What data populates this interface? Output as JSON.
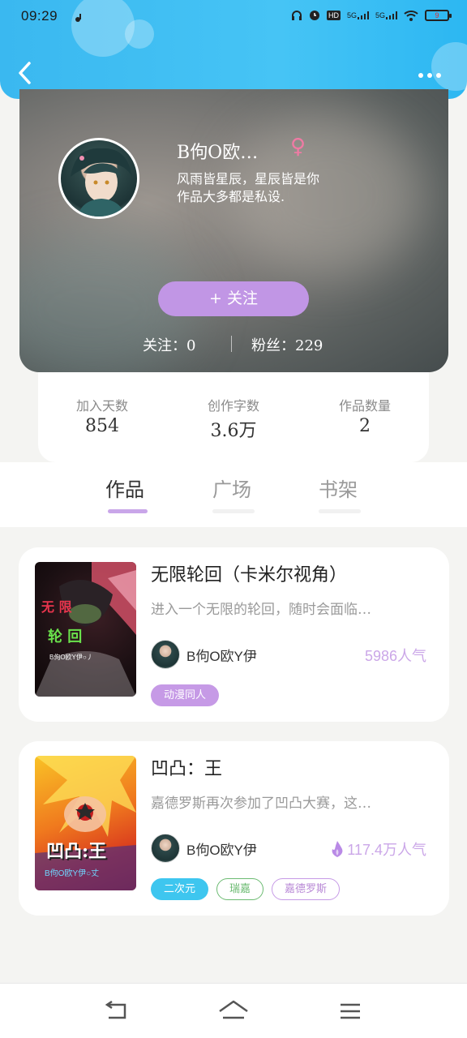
{
  "status_bar": {
    "time": "09:29",
    "network_1": "5G",
    "network_2": "5G",
    "battery": "9"
  },
  "header": {
    "back_icon": "chevron-left-icon",
    "more_icon": "more-dots-icon"
  },
  "profile": {
    "username": "B佝O欧…",
    "gender_symbol": "♀",
    "bio_line1": "风雨皆星辰，星辰皆是你",
    "bio_line2": "作品大多都是私设.",
    "follow_button": "+  关注",
    "following_label": "关注：",
    "following_count": "0",
    "fans_label": "粉丝：",
    "fans_count": "229"
  },
  "stats": [
    {
      "label": "加入天数",
      "value": "854"
    },
    {
      "label": "创作字数",
      "value": "3.6万"
    },
    {
      "label": "作品数量",
      "value": "2"
    }
  ],
  "tabs": [
    {
      "label": "作品",
      "active": true
    },
    {
      "label": "广场",
      "active": false
    },
    {
      "label": "书架",
      "active": false
    }
  ],
  "works": [
    {
      "title": "无限轮回（卡米尔视角）",
      "description": "进入一个无限的轮回，随时会面临…",
      "author": "B佝O欧Y伊",
      "popularity": "5986人气",
      "cover_text_1": "无 限",
      "cover_text_2": "轮 回",
      "cover_caption": "B佝O欧Y伊○丿",
      "tags": [
        {
          "label": "动漫同人",
          "color": "#c69ae6"
        }
      ]
    },
    {
      "title": "凹凸：王",
      "description": "嘉德罗斯再次参加了凹凸大赛，这…",
      "author": "B佝O欧Y伊",
      "popularity": "117.4万人气",
      "popularity_icon": "flame-icon",
      "cover_text_1": "凹凸:王",
      "cover_caption": "B佝O欧Y伊○丈",
      "tags": [
        {
          "label": "二次元",
          "color": "#3ec6ef"
        },
        {
          "label": "瑞嘉",
          "color": "#6cbb72"
        },
        {
          "label": "嘉德罗斯",
          "color": "#c69ae6"
        }
      ]
    }
  ],
  "bottom_nav": {
    "back_icon": "back-icon",
    "home_icon": "home-icon",
    "menu_icon": "menu-icon"
  },
  "colors": {
    "header_blue": "#3ab8f0",
    "accent_purple": "#c196e5",
    "popularity_purple": "#cba7e8"
  }
}
